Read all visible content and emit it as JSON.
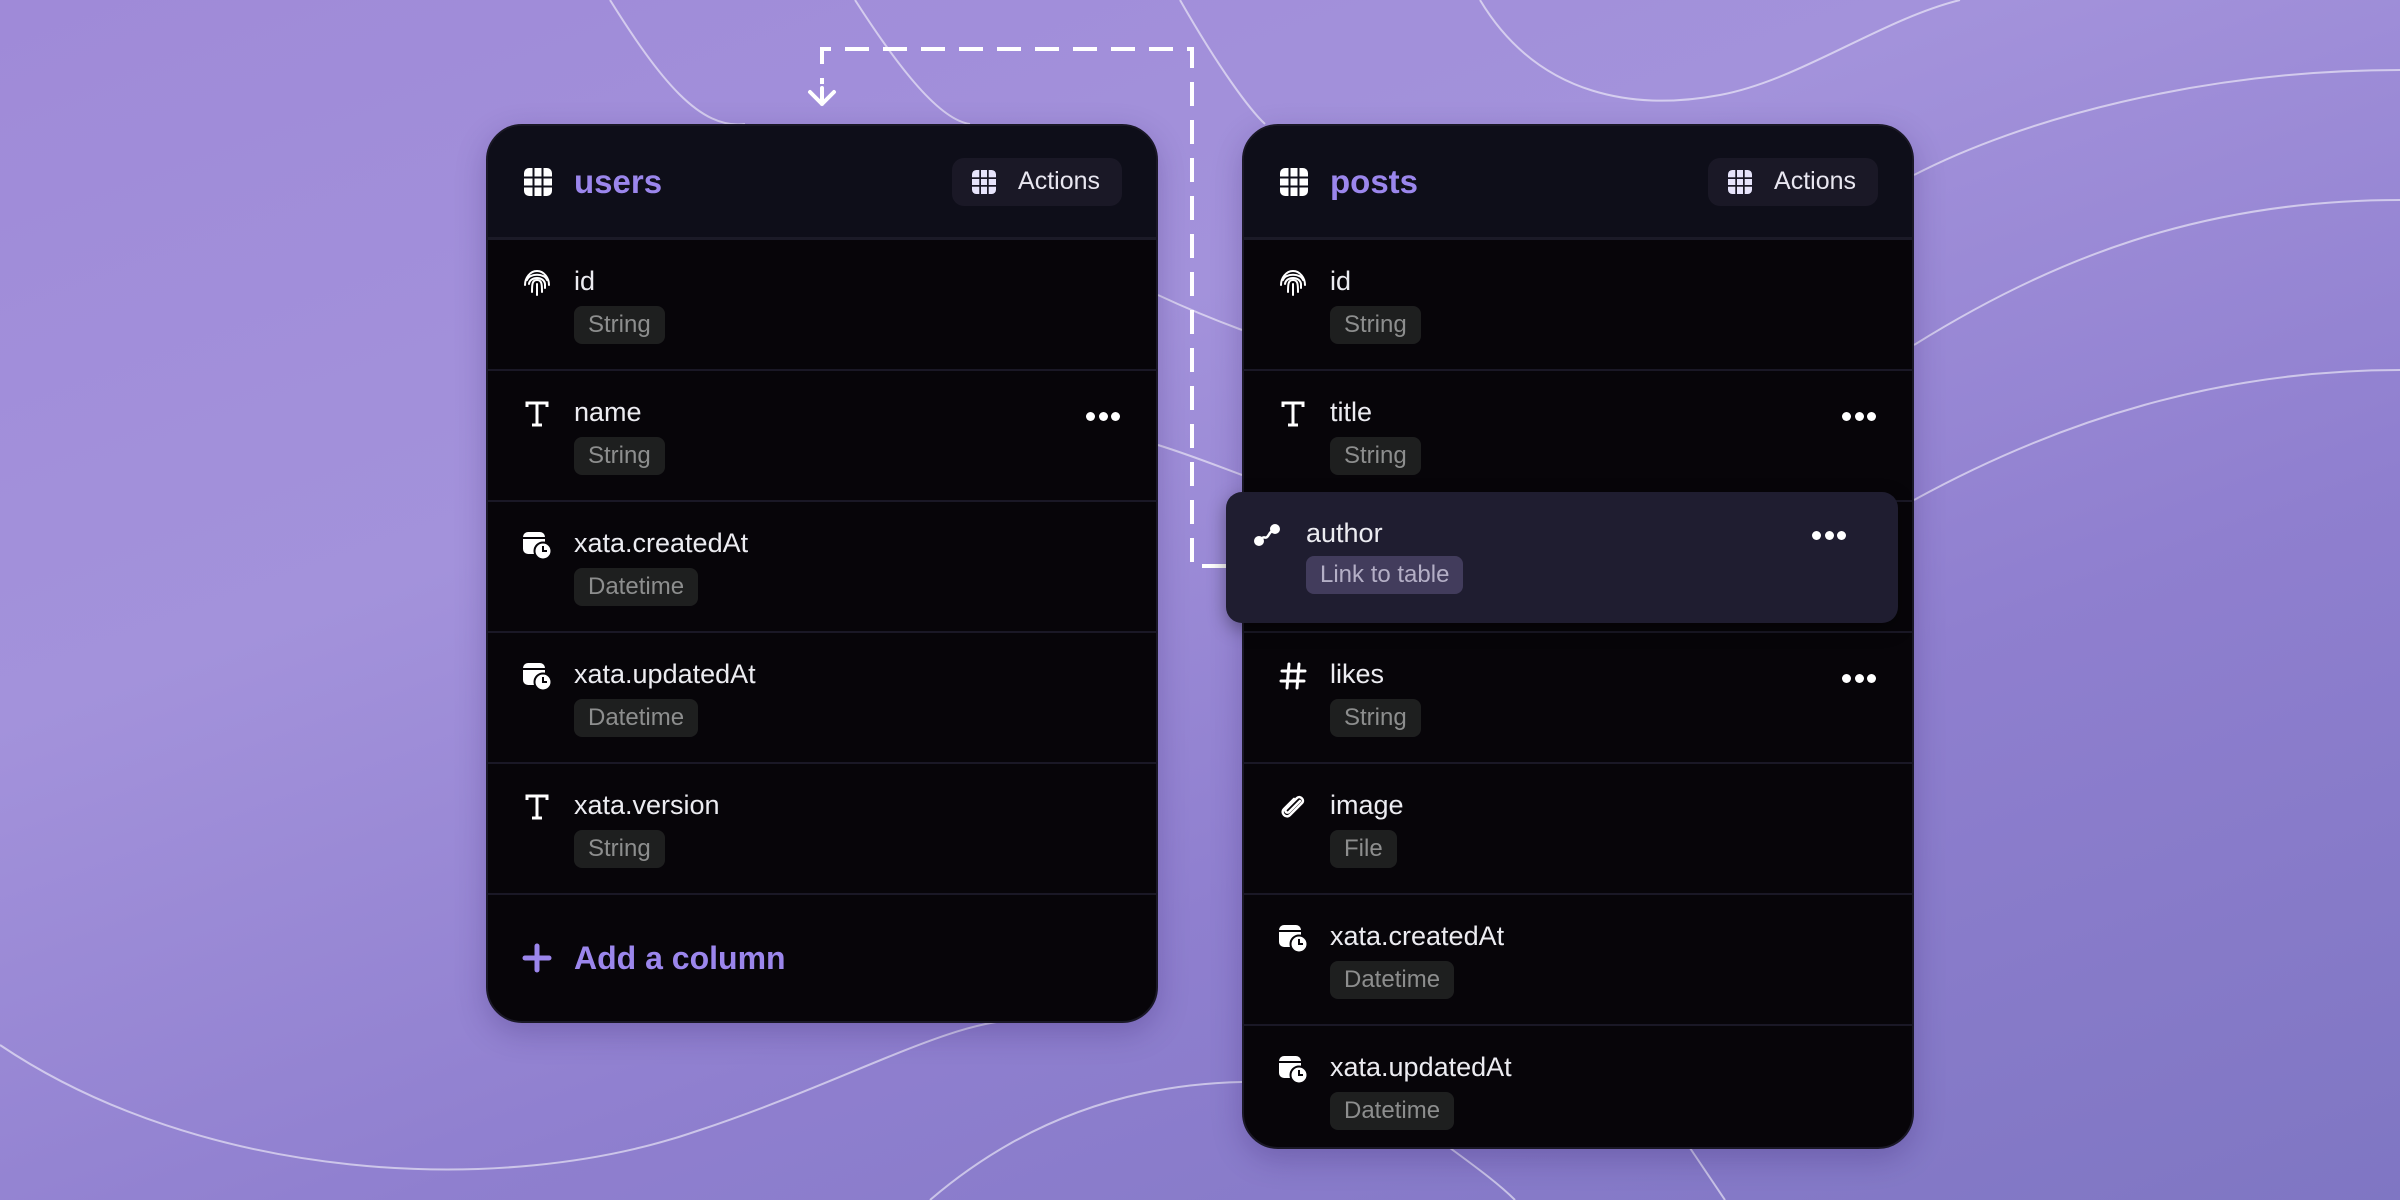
{
  "colors": {
    "accent": "#9b86ec",
    "background": "#9a88d6",
    "panel": "#070509",
    "panel_header": "#0e0e19",
    "highlight_card": "#1f1d30",
    "badge": "#1e1f1f",
    "link_badge": "#423c5c"
  },
  "tables": {
    "users": {
      "title": "users",
      "title_icon": "table-grid-icon",
      "actions_label": "Actions",
      "actions_icon": "table-grid-icon",
      "columns": [
        {
          "name": "id",
          "type": "String",
          "icon": "fingerprint-icon",
          "has_menu": false
        },
        {
          "name": "name",
          "type": "String",
          "icon": "text-type-icon",
          "has_menu": true
        },
        {
          "name": "xata.createdAt",
          "type": "Datetime",
          "icon": "calendar-clock-icon",
          "has_menu": false
        },
        {
          "name": "xata.updatedAt",
          "type": "Datetime",
          "icon": "calendar-clock-icon",
          "has_menu": false
        },
        {
          "name": "xata.version",
          "type": "String",
          "icon": "text-type-icon",
          "has_menu": false
        }
      ],
      "add_column_label": "Add a column",
      "add_column_icon": "plus-icon"
    },
    "posts": {
      "title": "posts",
      "title_icon": "table-grid-icon",
      "actions_label": "Actions",
      "actions_icon": "table-grid-icon",
      "columns": [
        {
          "name": "id",
          "type": "String",
          "icon": "fingerprint-icon",
          "has_menu": false
        },
        {
          "name": "title",
          "type": "String",
          "icon": "text-type-icon",
          "has_menu": true
        },
        {
          "name": "author",
          "type": "Link to table",
          "icon": "link-relation-icon",
          "has_menu": true,
          "highlighted": true
        },
        {
          "name": "likes",
          "type": "String",
          "icon": "hash-icon",
          "has_menu": true
        },
        {
          "name": "image",
          "type": "File",
          "icon": "paperclip-icon",
          "has_menu": false
        },
        {
          "name": "xata.createdAt",
          "type": "Datetime",
          "icon": "calendar-clock-icon",
          "has_menu": false
        },
        {
          "name": "xata.updatedAt",
          "type": "Datetime",
          "icon": "calendar-clock-icon",
          "has_menu": false
        }
      ]
    }
  },
  "connector": {
    "from": "posts.author",
    "to": "users",
    "style": "dashed-arrow"
  }
}
